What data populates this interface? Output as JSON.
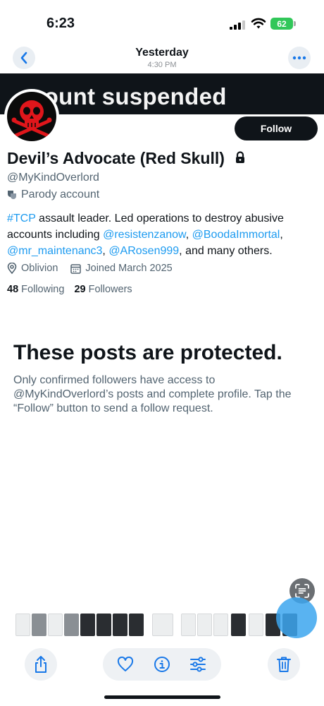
{
  "status_bar": {
    "time": "6:23",
    "battery": "62"
  },
  "nav": {
    "title": "Yesterday",
    "subtitle": "4:30 PM"
  },
  "banner": {
    "text": "count suspended"
  },
  "profile": {
    "follow_label": "Follow",
    "display_name": "Devil’s Advocate (Red Skull)",
    "handle": "@MyKindOverlord",
    "parody_label": "Parody account",
    "bio": {
      "hashtag": "#TCP",
      "text1": " assault leader. Led operations to destroy abusive accounts including ",
      "mention1": "@resistenzanow",
      "sep1": ", ",
      "mention2": "@BoodaImmortal",
      "sep2": ",",
      "mention3": "@mr_maintenanc3",
      "sep3": ", ",
      "mention4": "@ARosen999",
      "text2": ", and many others."
    },
    "location": "Oblivion",
    "joined": "Joined March 2025",
    "following_count": "48",
    "following_label": "Following",
    "followers_count": "29",
    "followers_label": "Followers"
  },
  "protected": {
    "title": "These posts are protected.",
    "body": "Only confirmed followers have access to @MyKindOverlord’s posts and complete profile. Tap the “Follow” button to send a follow request."
  },
  "colors": {
    "link": "#1d9bf0",
    "text": "#0f1419",
    "muted": "#536471",
    "follow_bg": "#0f1419",
    "avatar_skull": "#e0161b"
  },
  "icons": {
    "toolbar": [
      "share-icon",
      "heart-icon",
      "info-icon",
      "adjust-icon",
      "trash-icon"
    ],
    "overlay": "live-text-icon"
  }
}
